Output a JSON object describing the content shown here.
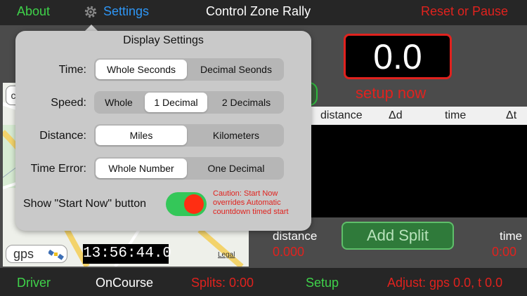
{
  "top": {
    "about": "About",
    "settings": "Settings",
    "title": "Control Zone Rally",
    "reset": "Reset or Pause"
  },
  "display": {
    "value": "0.0",
    "status": "setup now"
  },
  "table": {
    "headers": [
      "distance",
      "Δd",
      "time",
      "Δt"
    ]
  },
  "readouts": {
    "distance_label": "distance",
    "distance_value": "0.000",
    "time_label": "time",
    "time_value": "0:00",
    "add_split": "Add Split"
  },
  "map": {
    "gps": "gps",
    "clock": "13:56:44.0",
    "legal": "Legal",
    "corner": "c"
  },
  "bottom": {
    "driver": "Driver",
    "oncourse": "OnCourse",
    "splits": "Splits: 0:00",
    "setup": "Setup",
    "adjust": "Adjust: gps 0.0, t 0.0"
  },
  "settings": {
    "title": "Display Settings",
    "rows": {
      "time": {
        "label": "Time:",
        "options": [
          "Whole Seconds",
          "Decimal Seonds"
        ],
        "selected": "Whole Seconds"
      },
      "speed": {
        "label": "Speed:",
        "options": [
          "Whole",
          "1 Decimal",
          "2 Decimals"
        ],
        "selected": "1 Decimal"
      },
      "distance": {
        "label": "Distance:",
        "options": [
          "Miles",
          "Kilometers"
        ],
        "selected": "Miles"
      },
      "time_error": {
        "label": "Time Error:",
        "options": [
          "Whole Number",
          "One Decimal"
        ],
        "selected": "Whole Number"
      }
    },
    "start_now_label": "Show \"Start Now\" button",
    "start_now_on": true,
    "caution": "Caution: Start Now overrides Automatic countdown timed start"
  },
  "colors": {
    "green": "#3fd24a",
    "blue": "#2e96f5",
    "red": "#e0221e"
  }
}
